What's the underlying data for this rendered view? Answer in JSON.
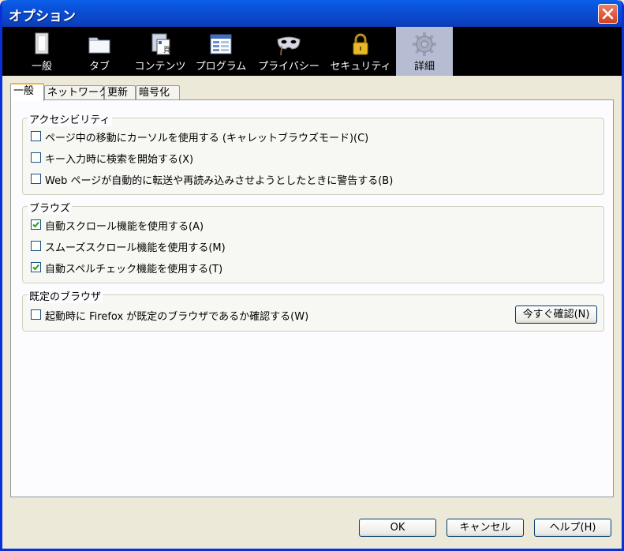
{
  "window": {
    "title": "オプション"
  },
  "toolbar": {
    "panes": [
      {
        "label": "一般",
        "icon": "general-icon"
      },
      {
        "label": "タブ",
        "icon": "tabs-icon"
      },
      {
        "label": "コンテンツ",
        "icon": "content-icon"
      },
      {
        "label": "プログラム",
        "icon": "applications-icon"
      },
      {
        "label": "プライバシー",
        "icon": "privacy-mask-icon"
      },
      {
        "label": "セキュリティ",
        "icon": "padlock-icon"
      },
      {
        "label": "詳細",
        "icon": "gear-icon",
        "selected": true
      }
    ]
  },
  "tabs": [
    {
      "label": "一般",
      "selected": true
    },
    {
      "label": "ネットワーク"
    },
    {
      "label": "更新"
    },
    {
      "label": "暗号化"
    }
  ],
  "accessibility": {
    "title": "アクセシビリティ",
    "items": [
      {
        "label": "ページ中の移動にカーソルを使用する (キャレットブラウズモード)(C)",
        "checked": false
      },
      {
        "label": "キー入力時に検索を開始する(X)",
        "checked": false
      },
      {
        "label": "Web ページが自動的に転送や再読み込みさせようとしたときに警告する(B)",
        "checked": false
      }
    ]
  },
  "browsing": {
    "title": "ブラウズ",
    "items": [
      {
        "label": "自動スクロール機能を使用する(A)",
        "checked": true
      },
      {
        "label": "スムーズスクロール機能を使用する(M)",
        "checked": false
      },
      {
        "label": "自動スペルチェック機能を使用する(T)",
        "checked": true
      }
    ]
  },
  "default_browser": {
    "title": "既定のブラウザ",
    "check_label": "起動時に Firefox が既定のブラウザであるか確認する(W)",
    "checked": false,
    "check_now_label": "今すぐ確認(N)"
  },
  "footer": {
    "ok_label": "OK",
    "cancel_label": "キャンセル",
    "help_label": "ヘルプ(H)"
  },
  "colors": {
    "titlebar": "#0a4fd6",
    "toolbar_bg": "#000000",
    "selected_pane": "#b6bdd2",
    "dialog_bg": "#ece9d8",
    "tab_accent": "#f9b13c"
  }
}
